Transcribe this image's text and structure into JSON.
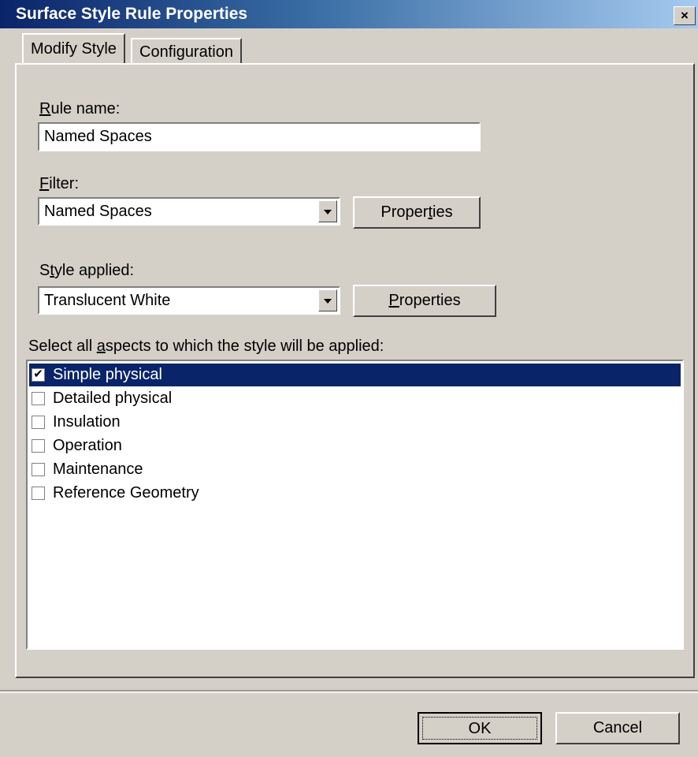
{
  "window": {
    "title": "Surface Style Rule Properties",
    "close_label": "×"
  },
  "tabs": [
    {
      "label": "Modify Style",
      "active": true
    },
    {
      "label": "Configuration",
      "active": false
    }
  ],
  "rule_name": {
    "label_key": "R",
    "label_rest": "ule name:",
    "value": "Named Spaces"
  },
  "filter": {
    "label_key": "F",
    "label_rest": "ilter:",
    "value": "Named Spaces",
    "properties_pre": "Proper",
    "properties_key": "t",
    "properties_post": "ies"
  },
  "style_applied": {
    "label_pre": "S",
    "label_key": "t",
    "label_rest": "yle applied:",
    "value": "Translucent White",
    "properties_key": "P",
    "properties_rest": "roperties"
  },
  "aspects": {
    "label_pre": "Select all ",
    "label_key": "a",
    "label_rest": "spects to which the style will be applied:",
    "items": [
      {
        "label": "Simple physical",
        "checked": true,
        "selected": true
      },
      {
        "label": "Detailed physical",
        "checked": false,
        "selected": false
      },
      {
        "label": "Insulation",
        "checked": false,
        "selected": false
      },
      {
        "label": "Operation",
        "checked": false,
        "selected": false
      },
      {
        "label": "Maintenance",
        "checked": false,
        "selected": false
      },
      {
        "label": "Reference Geometry",
        "checked": false,
        "selected": false
      }
    ]
  },
  "buttons": {
    "ok": "OK",
    "cancel": "Cancel"
  },
  "icons": {
    "check": "✔"
  },
  "colors": {
    "selection": "#0a246a",
    "face": "#d4d0c8"
  }
}
